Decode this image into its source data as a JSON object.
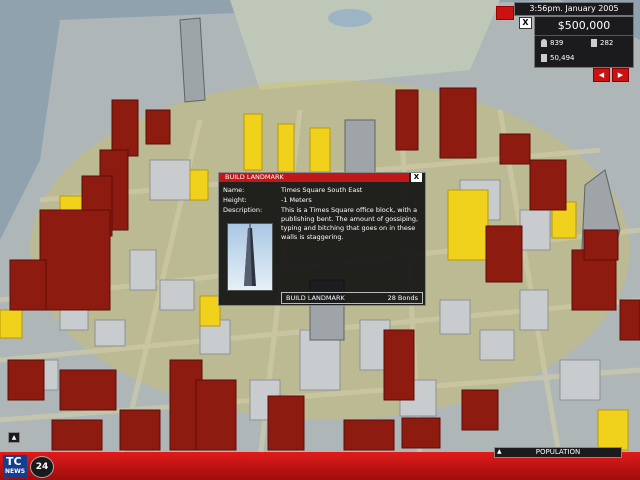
{
  "hud": {
    "time": "3:56pm. January 2005",
    "money": "$500,000",
    "stat_left": "839",
    "stat_right": "282",
    "population": "50,494",
    "close_label": "X",
    "prev_label": "◀",
    "next_label": "▶"
  },
  "dialog": {
    "title": "BUILD LANDMARK",
    "close_label": "X",
    "name_label": "Name:",
    "name_value": "Times Square South East",
    "height_label": "Height:",
    "height_value": "-1 Meters",
    "desc_label": "Description:",
    "desc_value": "This is a Times Square office block, with a publishing bent. The amount of gossiping, typing and bitching that goes on in these walls is staggering.",
    "build_label": "BUILD LANDMARK",
    "cost": "28 Bonds"
  },
  "bottom": {
    "logo_top": "TC",
    "logo_bottom": "NEWS",
    "badge": "24",
    "population_button": "POPULATION",
    "up_arrow": "▲"
  },
  "colors": {
    "red_building": "#8e1b10",
    "yellow_building": "#f0d21c",
    "highlight_zone": "#d8c24a",
    "bar_red": "#c41414"
  }
}
